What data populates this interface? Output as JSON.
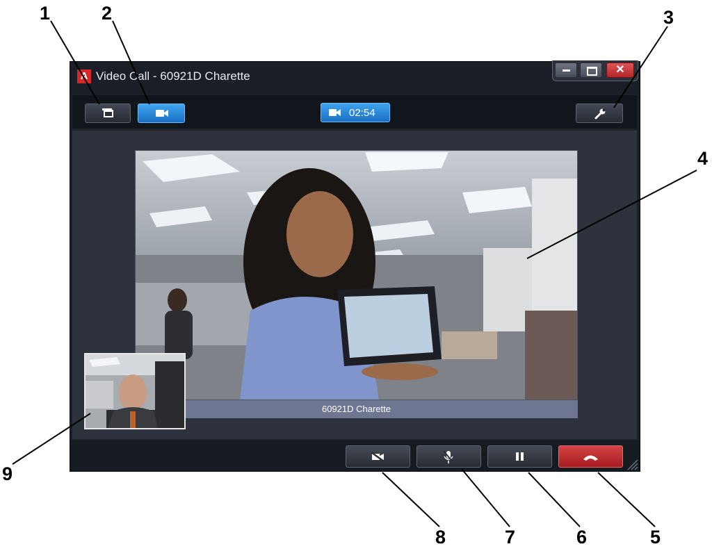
{
  "window": {
    "app_logo": "A",
    "title": "Video Call  - 60921D Charette",
    "controls": {
      "minimize_icon": "minimize-icon",
      "maximize_icon": "maximize-icon",
      "close_glyph": "✕"
    }
  },
  "toolbar": {
    "windows_button_icon": "windows-icon",
    "video_button_icon": "video-camera-icon",
    "call_timer": "02:54",
    "settings_button_icon": "wrench-icon"
  },
  "video": {
    "remote_name": "60921D Charette"
  },
  "controls": [
    {
      "id": "video-mute",
      "icon": "video-off-icon"
    },
    {
      "id": "mic-mute",
      "icon": "mic-off-icon"
    },
    {
      "id": "hold",
      "icon": "pause-icon"
    },
    {
      "id": "hangup",
      "icon": "hangup-icon"
    }
  ],
  "callouts": [
    "1",
    "2",
    "3",
    "4",
    "5",
    "6",
    "7",
    "8",
    "9"
  ],
  "colors": {
    "accent_blue": "#2b8ddc",
    "hangup_red": "#c0292c",
    "window_bg": "#1c2029",
    "name_strip": "#6f7692"
  }
}
